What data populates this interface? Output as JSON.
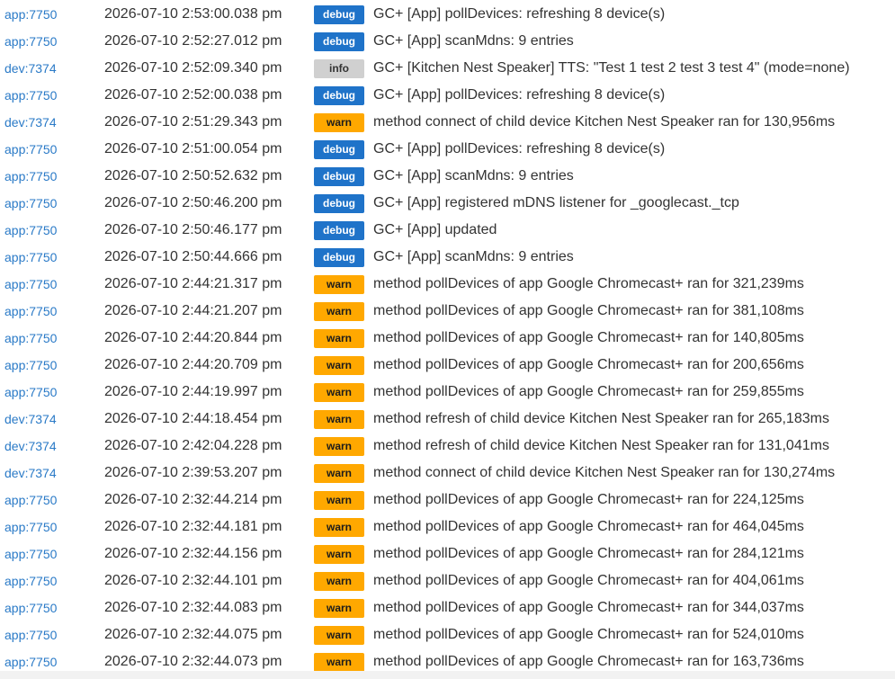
{
  "colors": {
    "debug": "#1f73c9",
    "warn": "#ffa800",
    "info": "#d0d0d0",
    "source_link": "#2a7ac7",
    "text": "#333333"
  },
  "log": [
    {
      "source": "app:7750",
      "time": "2026-07-10 2:53:00.038 pm",
      "level": "debug",
      "message": "GC+ [App] pollDevices: refreshing 8 device(s)"
    },
    {
      "source": "app:7750",
      "time": "2026-07-10 2:52:27.012 pm",
      "level": "debug",
      "message": "GC+ [App] scanMdns: 9 entries"
    },
    {
      "source": "dev:7374",
      "time": "2026-07-10 2:52:09.340 pm",
      "level": "info",
      "message": "GC+ [Kitchen Nest Speaker] TTS: \"Test 1 test 2 test 3 test 4\" (mode=none)"
    },
    {
      "source": "app:7750",
      "time": "2026-07-10 2:52:00.038 pm",
      "level": "debug",
      "message": "GC+ [App] pollDevices: refreshing 8 device(s)"
    },
    {
      "source": "dev:7374",
      "time": "2026-07-10 2:51:29.343 pm",
      "level": "warn",
      "message": "method connect of child device Kitchen Nest Speaker ran for 130,956ms"
    },
    {
      "source": "app:7750",
      "time": "2026-07-10 2:51:00.054 pm",
      "level": "debug",
      "message": "GC+ [App] pollDevices: refreshing 8 device(s)"
    },
    {
      "source": "app:7750",
      "time": "2026-07-10 2:50:52.632 pm",
      "level": "debug",
      "message": "GC+ [App] scanMdns: 9 entries"
    },
    {
      "source": "app:7750",
      "time": "2026-07-10 2:50:46.200 pm",
      "level": "debug",
      "message": "GC+ [App] registered mDNS listener for _googlecast._tcp"
    },
    {
      "source": "app:7750",
      "time": "2026-07-10 2:50:46.177 pm",
      "level": "debug",
      "message": "GC+ [App] updated"
    },
    {
      "source": "app:7750",
      "time": "2026-07-10 2:50:44.666 pm",
      "level": "debug",
      "message": "GC+ [App] scanMdns: 9 entries"
    },
    {
      "source": "app:7750",
      "time": "2026-07-10 2:44:21.317 pm",
      "level": "warn",
      "message": "method pollDevices of app Google Chromecast+ ran for 321,239ms"
    },
    {
      "source": "app:7750",
      "time": "2026-07-10 2:44:21.207 pm",
      "level": "warn",
      "message": "method pollDevices of app Google Chromecast+ ran for 381,108ms"
    },
    {
      "source": "app:7750",
      "time": "2026-07-10 2:44:20.844 pm",
      "level": "warn",
      "message": "method pollDevices of app Google Chromecast+ ran for 140,805ms"
    },
    {
      "source": "app:7750",
      "time": "2026-07-10 2:44:20.709 pm",
      "level": "warn",
      "message": "method pollDevices of app Google Chromecast+ ran for 200,656ms"
    },
    {
      "source": "app:7750",
      "time": "2026-07-10 2:44:19.997 pm",
      "level": "warn",
      "message": "method pollDevices of app Google Chromecast+ ran for 259,855ms"
    },
    {
      "source": "dev:7374",
      "time": "2026-07-10 2:44:18.454 pm",
      "level": "warn",
      "message": "method refresh of child device Kitchen Nest Speaker ran for 265,183ms"
    },
    {
      "source": "dev:7374",
      "time": "2026-07-10 2:42:04.228 pm",
      "level": "warn",
      "message": "method refresh of child device Kitchen Nest Speaker ran for 131,041ms"
    },
    {
      "source": "dev:7374",
      "time": "2026-07-10 2:39:53.207 pm",
      "level": "warn",
      "message": "method connect of child device Kitchen Nest Speaker ran for 130,274ms"
    },
    {
      "source": "app:7750",
      "time": "2026-07-10 2:32:44.214 pm",
      "level": "warn",
      "message": "method pollDevices of app Google Chromecast+ ran for 224,125ms"
    },
    {
      "source": "app:7750",
      "time": "2026-07-10 2:32:44.181 pm",
      "level": "warn",
      "message": "method pollDevices of app Google Chromecast+ ran for 464,045ms"
    },
    {
      "source": "app:7750",
      "time": "2026-07-10 2:32:44.156 pm",
      "level": "warn",
      "message": "method pollDevices of app Google Chromecast+ ran for 284,121ms"
    },
    {
      "source": "app:7750",
      "time": "2026-07-10 2:32:44.101 pm",
      "level": "warn",
      "message": "method pollDevices of app Google Chromecast+ ran for 404,061ms"
    },
    {
      "source": "app:7750",
      "time": "2026-07-10 2:32:44.083 pm",
      "level": "warn",
      "message": "method pollDevices of app Google Chromecast+ ran for 344,037ms"
    },
    {
      "source": "app:7750",
      "time": "2026-07-10 2:32:44.075 pm",
      "level": "warn",
      "message": "method pollDevices of app Google Chromecast+ ran for 524,010ms"
    },
    {
      "source": "app:7750",
      "time": "2026-07-10 2:32:44.073 pm",
      "level": "warn",
      "message": "method pollDevices of app Google Chromecast+ ran for 163,736ms"
    }
  ]
}
